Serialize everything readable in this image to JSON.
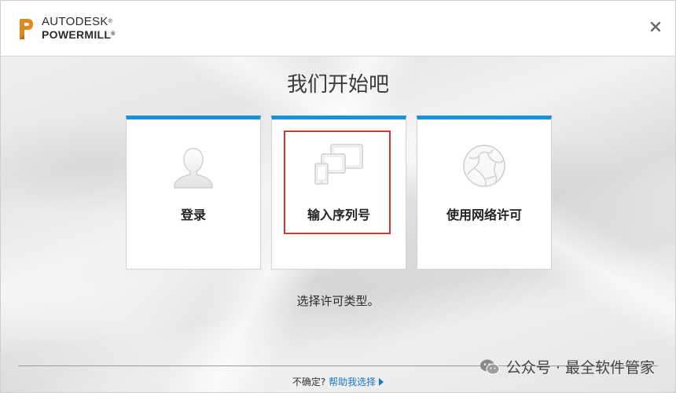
{
  "brand": {
    "company": "AUTODESK",
    "product": "POWERMILL",
    "trademark": "®",
    "logo_color": "#e08a1e"
  },
  "window": {
    "close_icon": "close-icon"
  },
  "main": {
    "headline": "我们开始吧",
    "cards": [
      {
        "label": "登录",
        "icon": "user-silhouette-icon"
      },
      {
        "label": "输入序列号",
        "icon": "devices-icon"
      },
      {
        "label": "使用网络许可",
        "icon": "network-globe-icon"
      }
    ],
    "card_accent_color": "#1a90d6",
    "highlight_color": "#d9332b",
    "prompt": "选择许可类型。"
  },
  "footer": {
    "question": "不确定?",
    "help_link": "帮助我选择"
  },
  "watermark": {
    "text": "公众号 · 最全软件管家",
    "icon": "wechat-icon"
  }
}
